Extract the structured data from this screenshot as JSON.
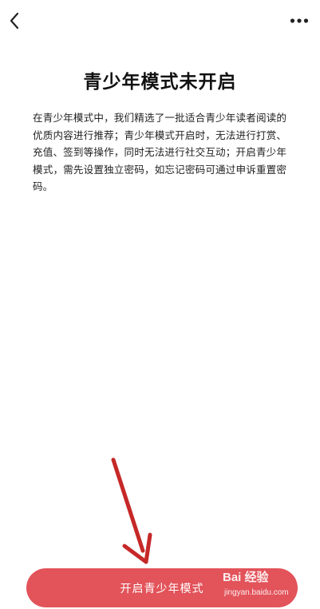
{
  "header": {
    "back_icon": "chevron-left-icon",
    "more_icon": "more-horizontal-icon"
  },
  "main": {
    "title": "青少年模式未开启",
    "description": "在青少年模式中，我们精选了一批适合青少年读者阅读的优质内容进行推荐；青少年模式开启时，无法进行打赏、充值、签到等操作，同时无法进行社交互动；开启青少年模式，需先设置独立密码，如忘记密码可通过申诉重置密码。"
  },
  "footer": {
    "enable_label": "开启青少年模式",
    "button_color": "#e2535a"
  },
  "overlay": {
    "arrow_color": "#c62828"
  },
  "watermark": {
    "brand": "Bai 经验",
    "sub": "jingyan.baidu.com"
  }
}
